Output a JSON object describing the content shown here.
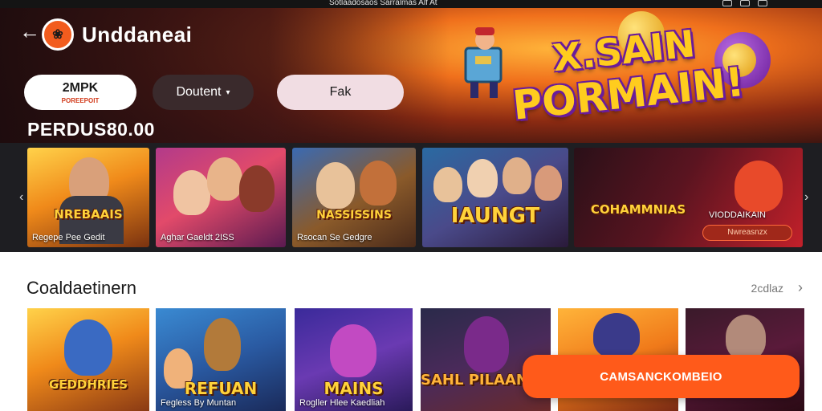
{
  "status_bar": {
    "text": "Sotlaadosaos Sarralmas Alf At"
  },
  "header": {
    "back_icon": "arrow-left-icon",
    "logo_icon": "brand-logo-icon",
    "app_title": "Unddaneai"
  },
  "pills": {
    "first_label": "2MPK",
    "first_sublabel": "POREEPOIT",
    "dropdown_label": "Doutent",
    "dropdown_icon": "chevron-down-icon",
    "third_label": "Fak"
  },
  "balance": "PERDUS80.00",
  "promo": {
    "line1": "X.SAIN",
    "line2": "PORMAIN!"
  },
  "featured": [
    {
      "caption": "Regepe Pee Gedit",
      "banner": "NREBAAIS"
    },
    {
      "caption": "Aghar Gaeldt 2ISS",
      "banner": ""
    },
    {
      "caption": "Rsocan Se Gedgre",
      "banner": "NASSISSINS"
    },
    {
      "caption": "",
      "banner": "IAUNGT"
    },
    {
      "caption": "VIODDAIKAIN",
      "banner": "COHAMMNIAS",
      "badge": "Nwreasnzx"
    }
  ],
  "section": {
    "title": "Coaldaetinern",
    "see_all": "2cdlaz"
  },
  "games": [
    {
      "caption": "",
      "banner": "GEDDHRIES"
    },
    {
      "caption": "Fegless By Muntan",
      "banner": "REFUAN"
    },
    {
      "caption": "Rogller Hlee Kaedliah",
      "banner": "MAINS"
    },
    {
      "caption": "",
      "banner": "SAHL PILAANNS"
    },
    {
      "caption": "",
      "banner": ""
    },
    {
      "caption": "",
      "banner": ""
    }
  ],
  "cta_label": "CAMSANCKOMBEIO"
}
